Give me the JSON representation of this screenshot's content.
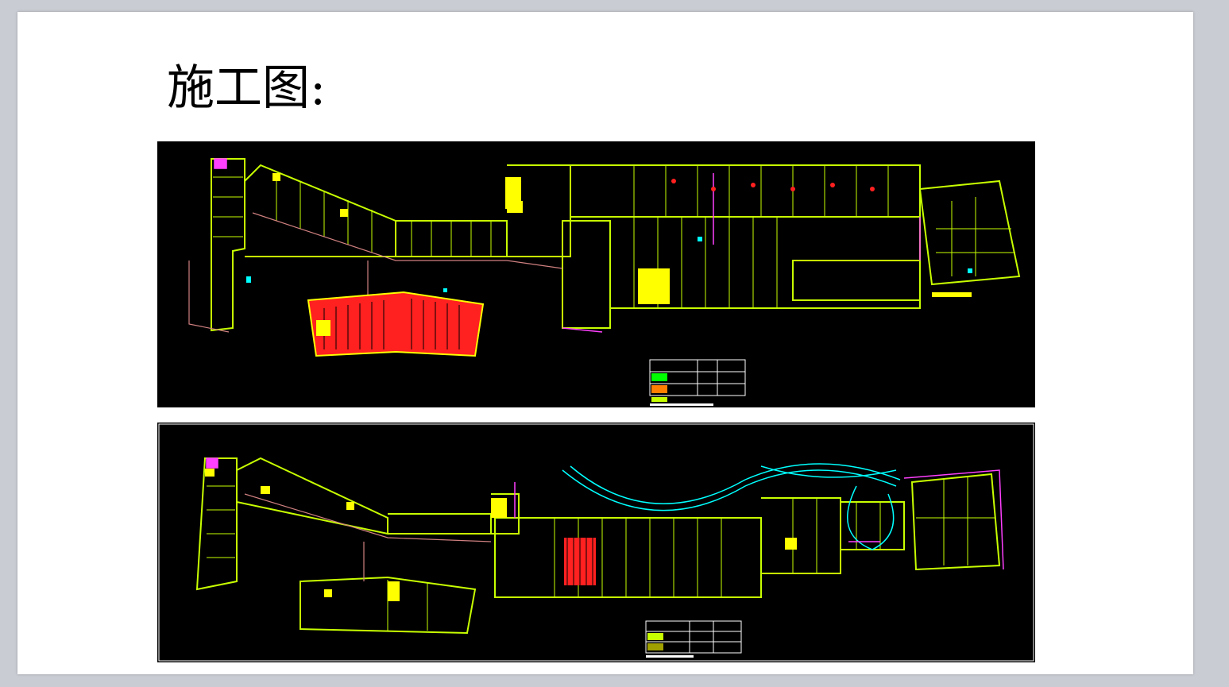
{
  "slide": {
    "title": "施工图:"
  },
  "drawings": [
    {
      "kind": "cad-floor-plan",
      "legend_rows": 3
    },
    {
      "kind": "cad-floor-plan",
      "legend_rows": 3
    }
  ],
  "colors": {
    "background": "#000000",
    "walls": "#c8ff00",
    "hatch_red": "#ff2020",
    "fill_yellow": "#ffff00",
    "accent_magenta": "#ff40ff",
    "accent_cyan": "#00ffff"
  }
}
